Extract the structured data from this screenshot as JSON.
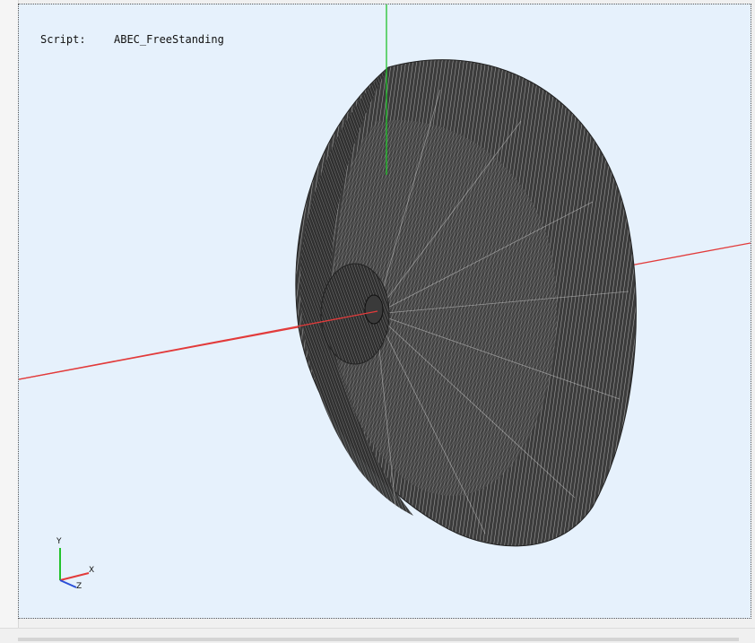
{
  "viewer": {
    "script_label": "Script:",
    "script_name": "ABEC_FreeStanding",
    "background_color": "#e6f1fc"
  },
  "axes_indicator": {
    "y_label": "Y",
    "x_label": "X",
    "z_label": "Z",
    "x_color": "#e23b3b",
    "y_color": "#22c22c",
    "z_color": "#2b4fd8"
  },
  "model": {
    "mesh_color": "#3a3a3a",
    "line_color": "#9a9a9a"
  }
}
